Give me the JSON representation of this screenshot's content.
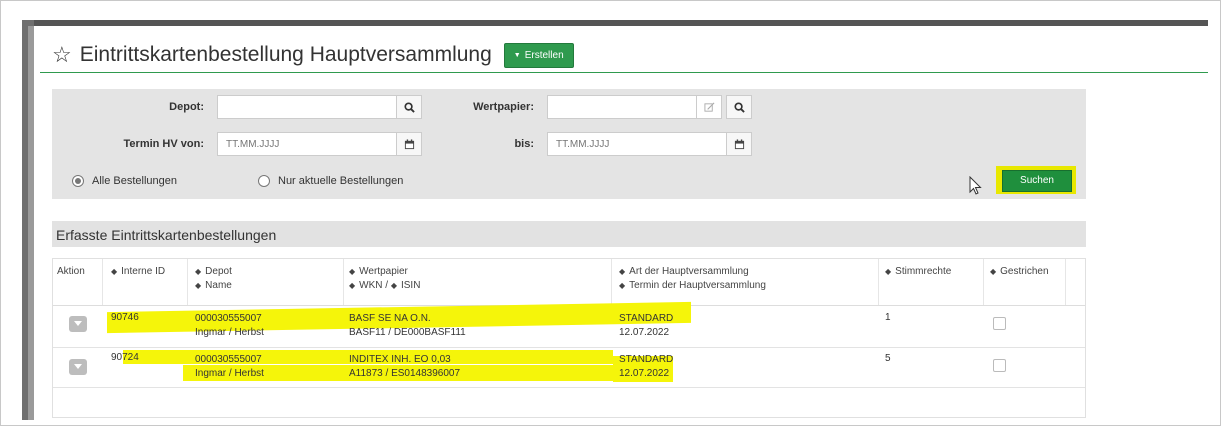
{
  "page": {
    "title": "Eintrittskartenbestellung Hauptversammlung",
    "create_button": "Erstellen"
  },
  "search": {
    "depot_label": "Depot:",
    "depot_value": "",
    "wertpapier_label": "Wertpapier:",
    "wertpapier_value": "",
    "termin_von_label": "Termin HV von:",
    "termin_von_placeholder": "TT.MM.JJJJ",
    "bis_label": "bis:",
    "bis_placeholder": "TT.MM.JJJJ",
    "radio_all": "Alle Bestellungen",
    "radio_current": "Nur aktuelle Bestellungen",
    "selected_radio": "all",
    "search_button": "Suchen"
  },
  "results": {
    "title": "Erfasste Eintrittskartenbestellungen",
    "columns": {
      "aktion": "Aktion",
      "interne_id": "Interne ID",
      "depot": "Depot",
      "name": "Name",
      "wertpapier": "Wertpapier",
      "wkn": "WKN /",
      "isin": "ISIN",
      "art": "Art der Hauptversammlung",
      "termin": "Termin der Hauptversammlung",
      "stimmrechte": "Stimmrechte",
      "gestrichen": "Gestrichen"
    },
    "rows": [
      {
        "id": "90746",
        "depot": "000030555007",
        "name": "Ingmar / Herbst",
        "wertpapier": "BASF SE NA O.N.",
        "wkn_isin": "BASF11 / DE000BASF111",
        "art": "STANDARD",
        "termin": "12.07.2022",
        "stimmrechte": "1"
      },
      {
        "id": "90724",
        "depot": "000030555007",
        "name": "Ingmar / Herbst",
        "wertpapier": "INDITEX INH. EO 0,03",
        "wkn_isin": "A11873 / ES0148396007",
        "art": "STANDARD",
        "termin": "12.07.2022",
        "stimmrechte": "5"
      }
    ]
  },
  "colors": {
    "accent_green": "#2f9a4e",
    "highlight_yellow": "#f5f50a",
    "panel_gray": "#e4e4e4"
  }
}
